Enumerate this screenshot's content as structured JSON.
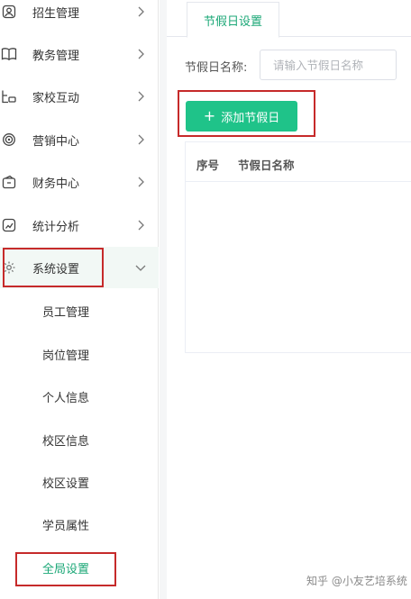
{
  "sidebar": {
    "items": [
      {
        "label": "招生管理",
        "icon": "person-icon"
      },
      {
        "label": "教务管理",
        "icon": "book-icon"
      },
      {
        "label": "家校互动",
        "icon": "chat-icon"
      },
      {
        "label": "营销中心",
        "icon": "target-icon"
      },
      {
        "label": "财务中心",
        "icon": "wallet-icon"
      },
      {
        "label": "统计分析",
        "icon": "chart-icon"
      },
      {
        "label": "系统设置",
        "icon": "gear-icon"
      }
    ],
    "sub_items": [
      "员工管理",
      "岗位管理",
      "个人信息",
      "校区信息",
      "校区设置",
      "学员属性",
      "全局设置"
    ],
    "active_sub": "全局设置"
  },
  "main": {
    "tab": "节假日设置",
    "filter_label": "节假日名称:",
    "filter_placeholder": "请输入节假日名称",
    "add_button": "添加节假日",
    "table_headers": [
      "序号",
      "节假日名称"
    ]
  },
  "watermark": "知乎 @小友艺培系统",
  "colors": {
    "accent": "#1fc389",
    "accent_text": "#1aa776",
    "highlight": "#c62a2a"
  }
}
